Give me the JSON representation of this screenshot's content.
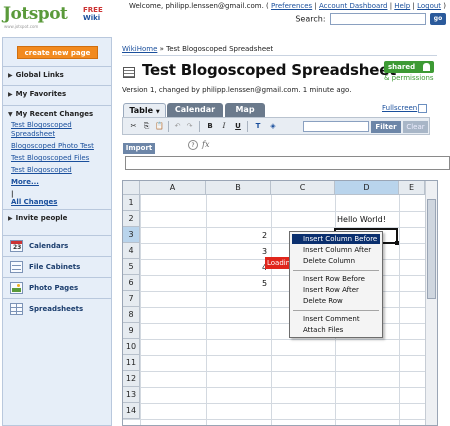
{
  "brand": {
    "name": "Jotspot",
    "free": "FREE",
    "wiki": "Wiki",
    "tagline": "www.jotspot.com"
  },
  "topbar": {
    "welcome_prefix": "Welcome, philipp.lenssen@gmail.com. ( ",
    "links": [
      "Preferences",
      "Account Dashboard",
      "Help",
      "Logout"
    ],
    "welcome_suffix": " )",
    "search_label": "Search:",
    "search_value": "",
    "go_label": "go"
  },
  "sidebar": {
    "create_label": "create new page",
    "global_links": "Global Links",
    "my_favorites": "My Favorites",
    "recent_changes": "My Recent Changes",
    "recent_items": [
      "Test Blogoscoped Spreadsheet",
      "Blogoscoped Photo Test",
      "Test Blogoscoped Files",
      "Test Blogoscoped"
    ],
    "more_label": "More...",
    "all_changes_label": "All Changes",
    "invite_label": "Invite people",
    "apps": [
      "Calendars",
      "File Cabinets",
      "Photo Pages",
      "Spreadsheets"
    ]
  },
  "page": {
    "breadcrumb_home": "WikiHome",
    "breadcrumb_sep": " » ",
    "breadcrumb_current": "Test Blogoscoped Spreadsheet",
    "title": "Test Blogoscoped Spreadsheet",
    "shared_label": "shared",
    "permissions_label": "& permissions",
    "version_text": "Version 1, changed by philipp.lenssen@gmail.com. 1 minute ago.",
    "fullscreen_label": "Fullscreen"
  },
  "tabs": [
    "Table",
    "Calendar",
    "Map"
  ],
  "toolbar": {
    "bold": "B",
    "italic": "I",
    "underline": "U",
    "filter_label": "Filter",
    "clear_label": "Clear",
    "filter_value": "",
    "import_label": "Import",
    "help": "?",
    "fx": "fx",
    "formula_value": ""
  },
  "grid": {
    "columns": [
      "A",
      "B",
      "C",
      "D",
      "E"
    ],
    "selected_column": "D",
    "selected_row": 3,
    "rows": [
      1,
      2,
      3,
      4,
      5,
      6,
      7,
      8,
      9,
      10,
      11,
      12,
      13,
      14
    ],
    "cells": {
      "D2": "Hello World!",
      "B3": "2",
      "C4": "3",
      "B5": "4",
      "B6": "5"
    },
    "loading_text": "Loading"
  },
  "context_menu": {
    "items": [
      "Insert Column Before",
      "Insert Column After",
      "Delete Column",
      "Insert Row Before",
      "Insert Row After",
      "Delete Row",
      "Insert Comment",
      "Attach Files"
    ],
    "highlighted": "Insert Column Before"
  }
}
